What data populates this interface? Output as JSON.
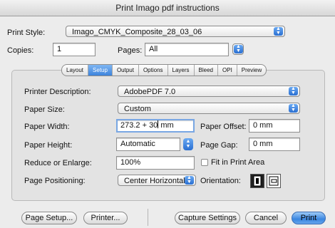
{
  "window": {
    "title": "Print Imago pdf instructions"
  },
  "top": {
    "print_style_label": "Print Style:",
    "print_style_value": "Imago_CMYK_Composite_28_03_06",
    "copies_label": "Copies:",
    "copies_value": "1",
    "pages_label": "Pages:",
    "pages_value": "All"
  },
  "tabs": [
    {
      "label": "Layout",
      "active": false
    },
    {
      "label": "Setup",
      "active": true
    },
    {
      "label": "Output",
      "active": false
    },
    {
      "label": "Options",
      "active": false
    },
    {
      "label": "Layers",
      "active": false
    },
    {
      "label": "Bleed",
      "active": false
    },
    {
      "label": "OPI",
      "active": false
    },
    {
      "label": "Preview",
      "active": false
    }
  ],
  "setup": {
    "printer_description_label": "Printer Description:",
    "printer_description_value": "AdobePDF 7.0",
    "paper_size_label": "Paper Size:",
    "paper_size_value": "Custom",
    "paper_width_label": "Paper Width:",
    "paper_width_value_before_caret": "273.2 + 30",
    "paper_width_value_after_caret": " mm",
    "paper_offset_label": "Paper Offset:",
    "paper_offset_value": "0 mm",
    "paper_height_label": "Paper Height:",
    "paper_height_value": "Automatic",
    "page_gap_label": "Page Gap:",
    "page_gap_value": "0 mm",
    "reduce_enlarge_label": "Reduce or Enlarge:",
    "reduce_enlarge_value": "100%",
    "fit_in_print_area_label": "Fit in Print Area",
    "fit_in_print_area_checked": false,
    "page_positioning_label": "Page Positioning:",
    "page_positioning_value": "Center Horizontal",
    "orientation_label": "Orientation:",
    "orientation_selected": "portrait"
  },
  "buttons": {
    "page_setup": "Page Setup...",
    "printer": "Printer...",
    "capture_settings": "Capture Settings",
    "cancel": "Cancel",
    "print": "Print"
  },
  "colors": {
    "accent": "#3a86e0",
    "focus_ring": "#79a7e3"
  }
}
